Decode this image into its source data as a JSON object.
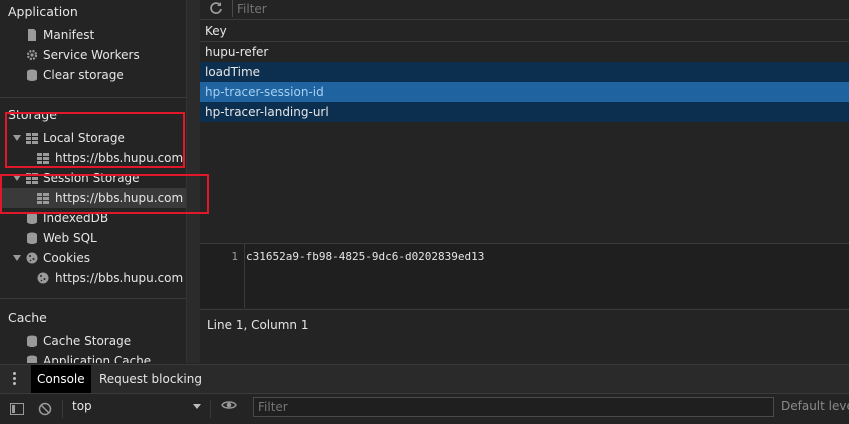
{
  "sidebar": {
    "application_title": "Application",
    "application_items": [
      {
        "label": "Manifest",
        "icon": "file-icon"
      },
      {
        "label": "Service Workers",
        "icon": "gear-icon"
      },
      {
        "label": "Clear storage",
        "icon": "database-icon"
      }
    ],
    "storage_title": "Storage",
    "local_storage": {
      "label": "Local Storage",
      "child": "https://bbs.hupu.com"
    },
    "session_storage": {
      "label": "Session Storage",
      "child": "https://bbs.hupu.com"
    },
    "indexeddb": "IndexedDB",
    "websql": "Web SQL",
    "cookies": {
      "label": "Cookies",
      "child": "https://bbs.hupu.com"
    },
    "cache_title": "Cache",
    "cache_items": [
      {
        "label": "Cache Storage"
      },
      {
        "label": "Application Cache"
      }
    ]
  },
  "toolbar": {
    "filter_placeholder": "Filter"
  },
  "table": {
    "column_key": "Key",
    "rows": [
      "hupu-refer",
      "loadTime",
      "hp-tracer-session-id",
      "hp-tracer-landing-url"
    ],
    "selected_index": 2
  },
  "value_pane": {
    "line_number": "1",
    "value": "c31652a9-fb98-4825-9dc6-d0202839ed13"
  },
  "status": {
    "text": "Line 1, Column 1"
  },
  "drawer": {
    "tabs": [
      "Console",
      "Request blocking"
    ],
    "active_tab": "Console"
  },
  "console": {
    "context": "top",
    "filter_placeholder": "Filter",
    "levels": "Default levels"
  },
  "colors": {
    "selected_row": "#1f64a0",
    "highlight_box": "#e0182a",
    "alt_row": "#0c2f4f"
  }
}
